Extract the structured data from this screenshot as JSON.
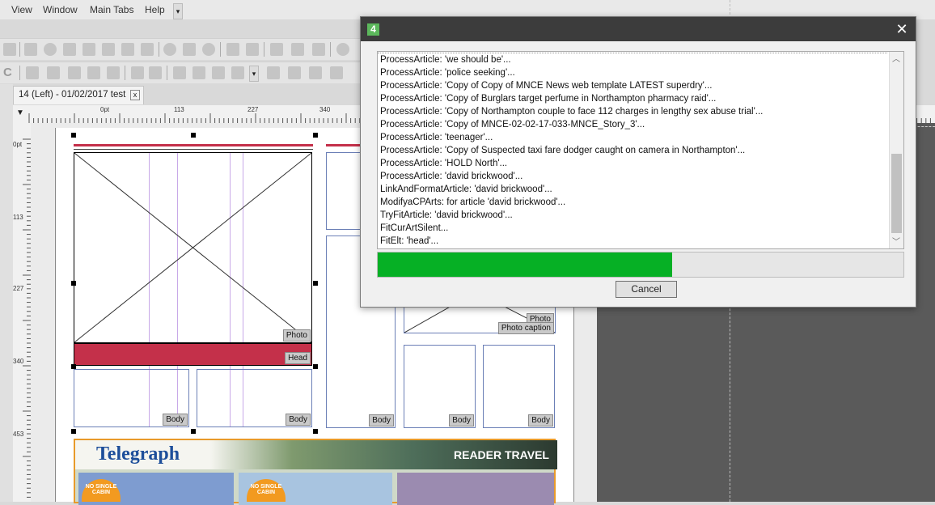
{
  "menu": {
    "items": [
      "View",
      "Window",
      "Main Tabs",
      "Help"
    ]
  },
  "document_tab": {
    "title": "14 (Left) - 01/02/2017 test",
    "close_glyph": "x"
  },
  "ruler": {
    "top_labels": [
      "0pt",
      "113",
      "227",
      "340"
    ],
    "left_labels": [
      "0pt",
      "113",
      "227",
      "340",
      "453"
    ]
  },
  "page": {
    "frame_tags": {
      "photo": "Photo",
      "head": "Head",
      "body": "Body",
      "photo2": "Photo",
      "photo_caption": "Photo caption"
    },
    "ad": {
      "masthead": "Telegraph",
      "banner": "READER TRAVEL",
      "badge": "NO SINGLE CABIN"
    }
  },
  "dialog": {
    "badge": "4",
    "close_glyph": "✕",
    "log_lines": [
      "ProcessArticle: 'we should be'...",
      "ProcessArticle: 'police seeking'...",
      "ProcessArticle: 'Copy of Copy of MNCE News web template LATEST superdry'...",
      "ProcessArticle: 'Copy of Burglars target perfume in Northampton pharmacy raid'...",
      "ProcessArticle: 'Copy of Northampton couple to face 112 charges in lengthy sex abuse trial'...",
      "ProcessArticle: 'Copy of MNCE-02-02-17-033-MNCE_Story_3'...",
      "ProcessArticle: 'teenager'...",
      "ProcessArticle: 'Copy of Suspected taxi fare dodger caught on camera in Northampton'...",
      "ProcessArticle: 'HOLD North'...",
      "ProcessArticle: 'david brickwood'...",
      "LinkAndFormatArticle: 'david brickwood'...",
      "ModifyaCPArts: for article 'david brickwood'...",
      "TryFitArticle: 'david brickwood'...",
      "FitCurArtSilent...",
      "FitElt: 'head'..."
    ],
    "progress_fraction": 0.56,
    "cancel_label": "Cancel"
  },
  "colors": {
    "progress": "#06b025",
    "headline_bar": "#c4304a",
    "dialog_title": "#3c3c3c",
    "badge": "#5cb85c"
  }
}
